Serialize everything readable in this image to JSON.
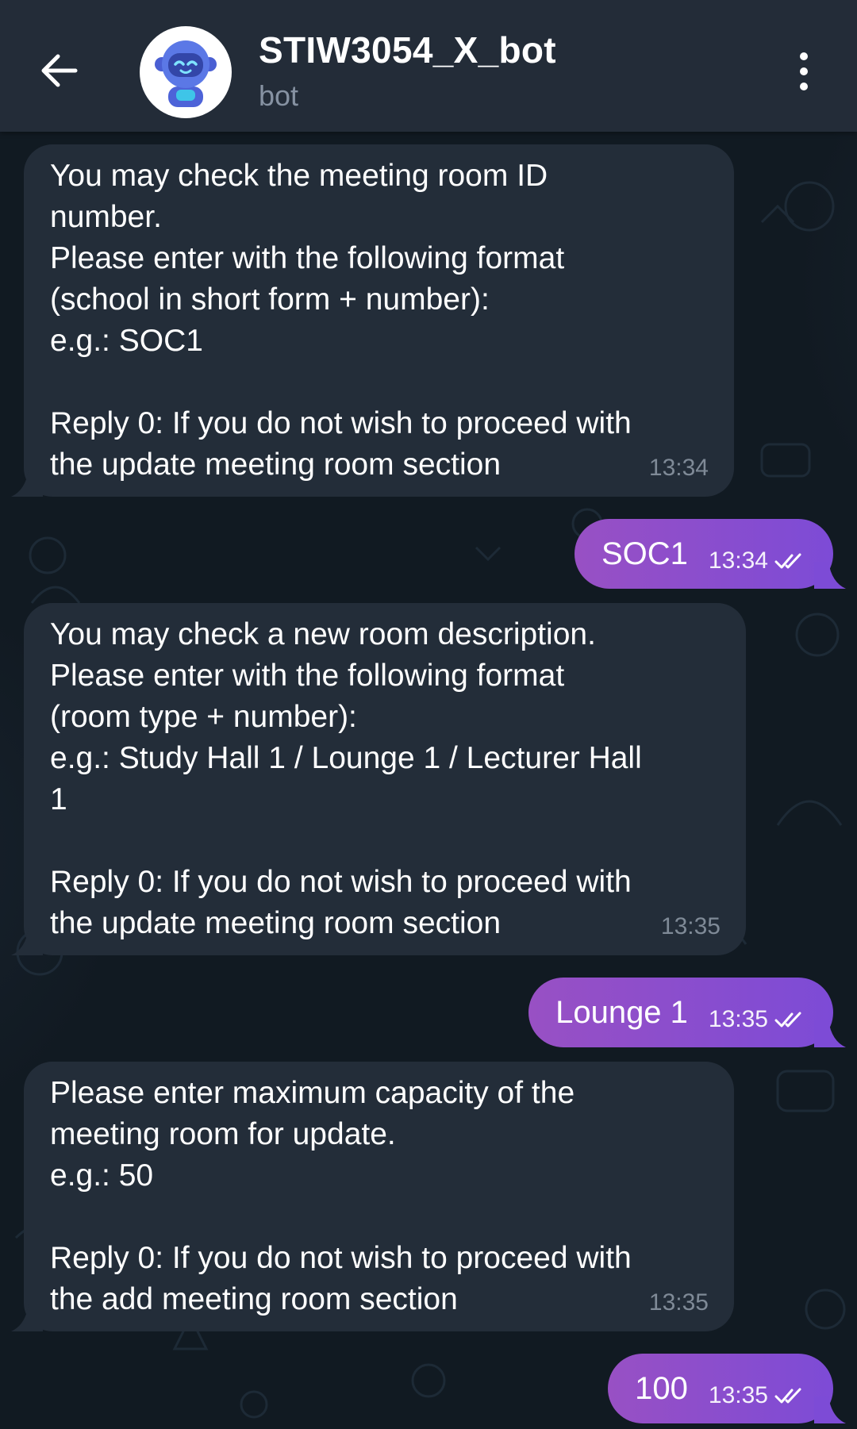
{
  "header": {
    "title": "STIW3054_X_bot",
    "subtitle": "bot"
  },
  "messages": [
    {
      "direction": "incoming",
      "text": "You may check the meeting room ID\nnumber.\nPlease enter with the following format\n(school in short form + number):\ne.g.: SOC1\n\nReply 0: If you do not wish to proceed with\nthe update meeting room section",
      "time": "13:34"
    },
    {
      "direction": "outgoing",
      "text": "SOC1",
      "time": "13:34",
      "status": "read"
    },
    {
      "direction": "incoming",
      "text": "You may check a new room description.\nPlease enter with the following format\n(room type + number):\ne.g.: Study Hall 1 / Lounge 1 / Lecturer Hall\n1\n\nReply 0: If you do not wish to proceed with\nthe update meeting room section",
      "time": "13:35"
    },
    {
      "direction": "outgoing",
      "text": "Lounge 1",
      "time": "13:35",
      "status": "read"
    },
    {
      "direction": "incoming",
      "text": "Please enter maximum capacity of the\nmeeting room for update.\ne.g.: 50\n\nReply 0: If you do not wish to proceed with\nthe add meeting room section",
      "time": "13:35"
    },
    {
      "direction": "outgoing",
      "text": "100",
      "time": "13:35",
      "status": "read"
    }
  ],
  "icons": {
    "back": "arrow-left-icon",
    "menu": "more-vertical-icon",
    "avatar": "robot-avatar-icon",
    "read": "double-check-icon"
  },
  "colors": {
    "header_bg": "#232c38",
    "incoming_bubble": "#232d39",
    "outgoing_bubble_start": "#9850c4",
    "outgoing_bubble_end": "#7d4bd6"
  }
}
